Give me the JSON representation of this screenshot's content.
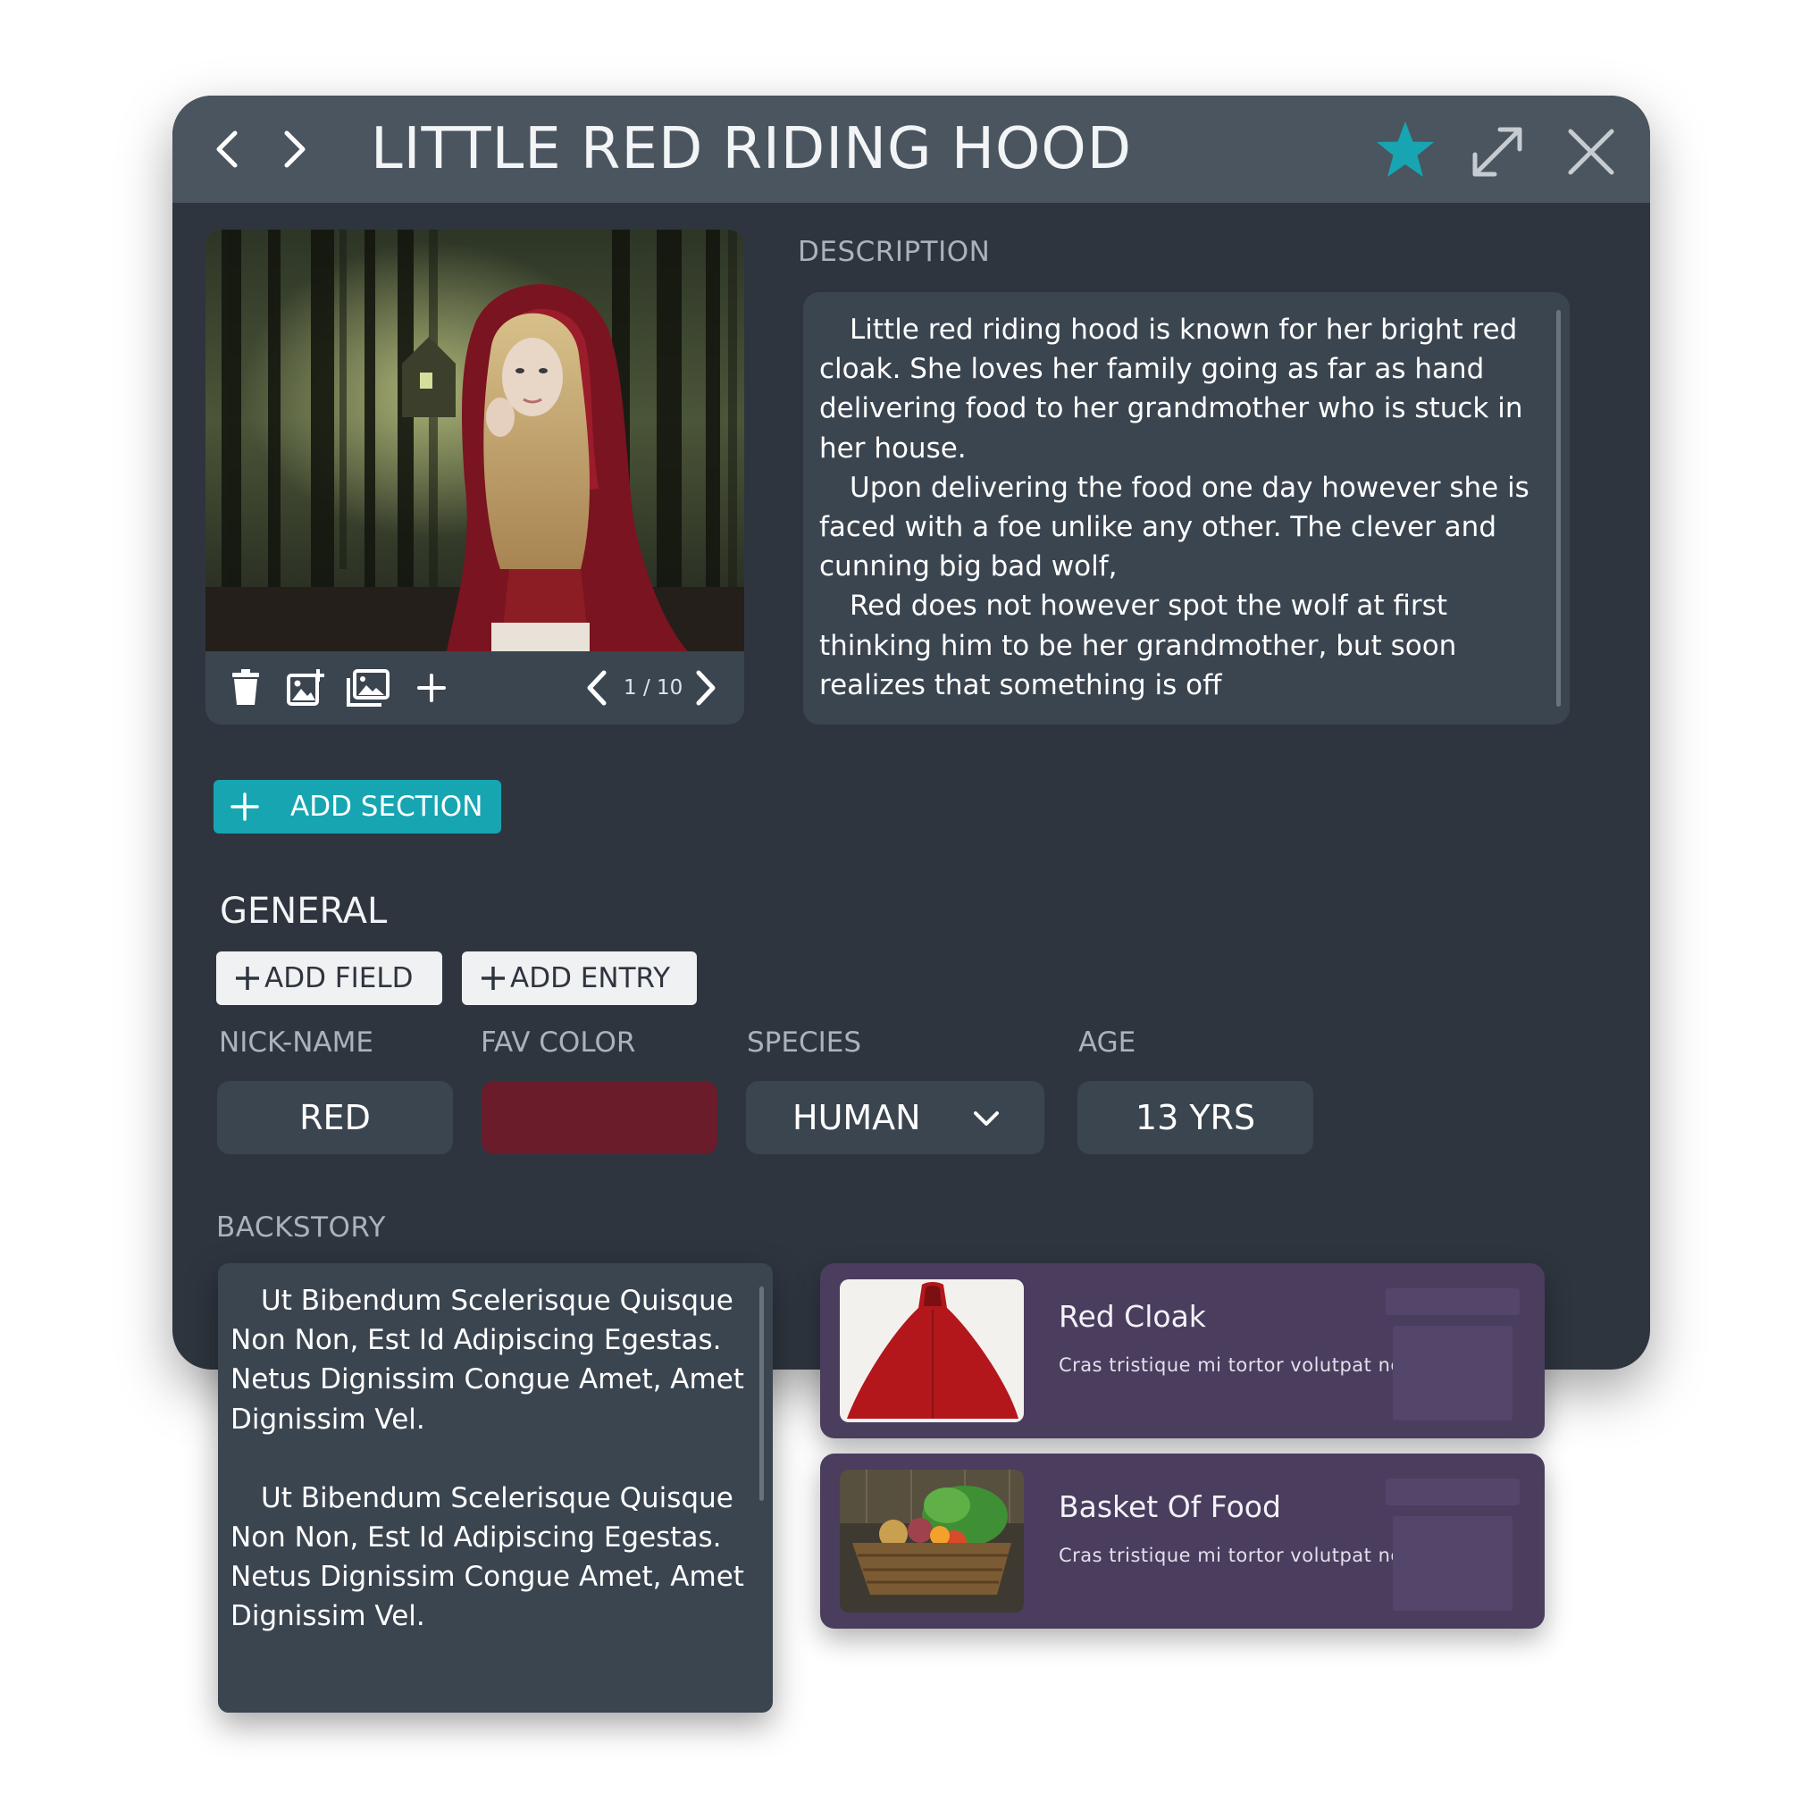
{
  "window": {
    "title": "LITTLE RED RIDING HOOD",
    "accent_color": "#17a5b2",
    "icons": {
      "back": "chevron-left-icon",
      "forward": "chevron-right-icon",
      "favorite": "star-icon",
      "expand": "expand-icon",
      "close": "close-icon"
    }
  },
  "gallery": {
    "page_indicator": "1 / 10",
    "icons": [
      "trash-icon",
      "add-image-icon",
      "gallery-icon",
      "plus-icon"
    ]
  },
  "description": {
    "label": "DESCRIPTION",
    "paragraphs": [
      "Little red riding hood is known for her bright red cloak. She loves her family going as far as hand delivering food to her grandmother who is stuck in her house.",
      "Upon delivering the food one day however she is faced with a foe unlike any other. The clever and cunning big bad wolf,",
      "Red does not however spot the wolf at first thinking him to be her grandmother, but soon realizes that something is off"
    ]
  },
  "add_section": {
    "label": "ADD SECTION"
  },
  "general": {
    "title": "GENERAL",
    "add_field_label": "ADD FIELD",
    "add_entry_label": "ADD ENTRY",
    "fields": {
      "nickname": {
        "label": "NICK-NAME",
        "value": "RED"
      },
      "fav_color": {
        "label": "FAV COLOR",
        "color": "#6b1c2a"
      },
      "species": {
        "label": "SPECIES",
        "value": "HUMAN"
      },
      "age": {
        "label": "AGE",
        "value": "13 YRS"
      }
    }
  },
  "backstory": {
    "label": "BACKSTORY",
    "paragraphs": [
      "Ut Bibendum Scelerisque Quisque Non Non, Est Id Adipiscing Egestas. Netus Dignissim Congue Amet, Amet Dignissim Vel.",
      "Ut Bibendum Scelerisque Quisque Non Non, Est Id Adipiscing Egestas. Netus Dignissim Congue Amet, Amet Dignissim Vel."
    ]
  },
  "entries": [
    {
      "title": "Red Cloak",
      "description": "Cras tristique mi tortor volutpat netus risus ..."
    },
    {
      "title": "Basket Of Food",
      "description": "Cras tristique mi tortor volutpat netus risus ..."
    }
  ]
}
